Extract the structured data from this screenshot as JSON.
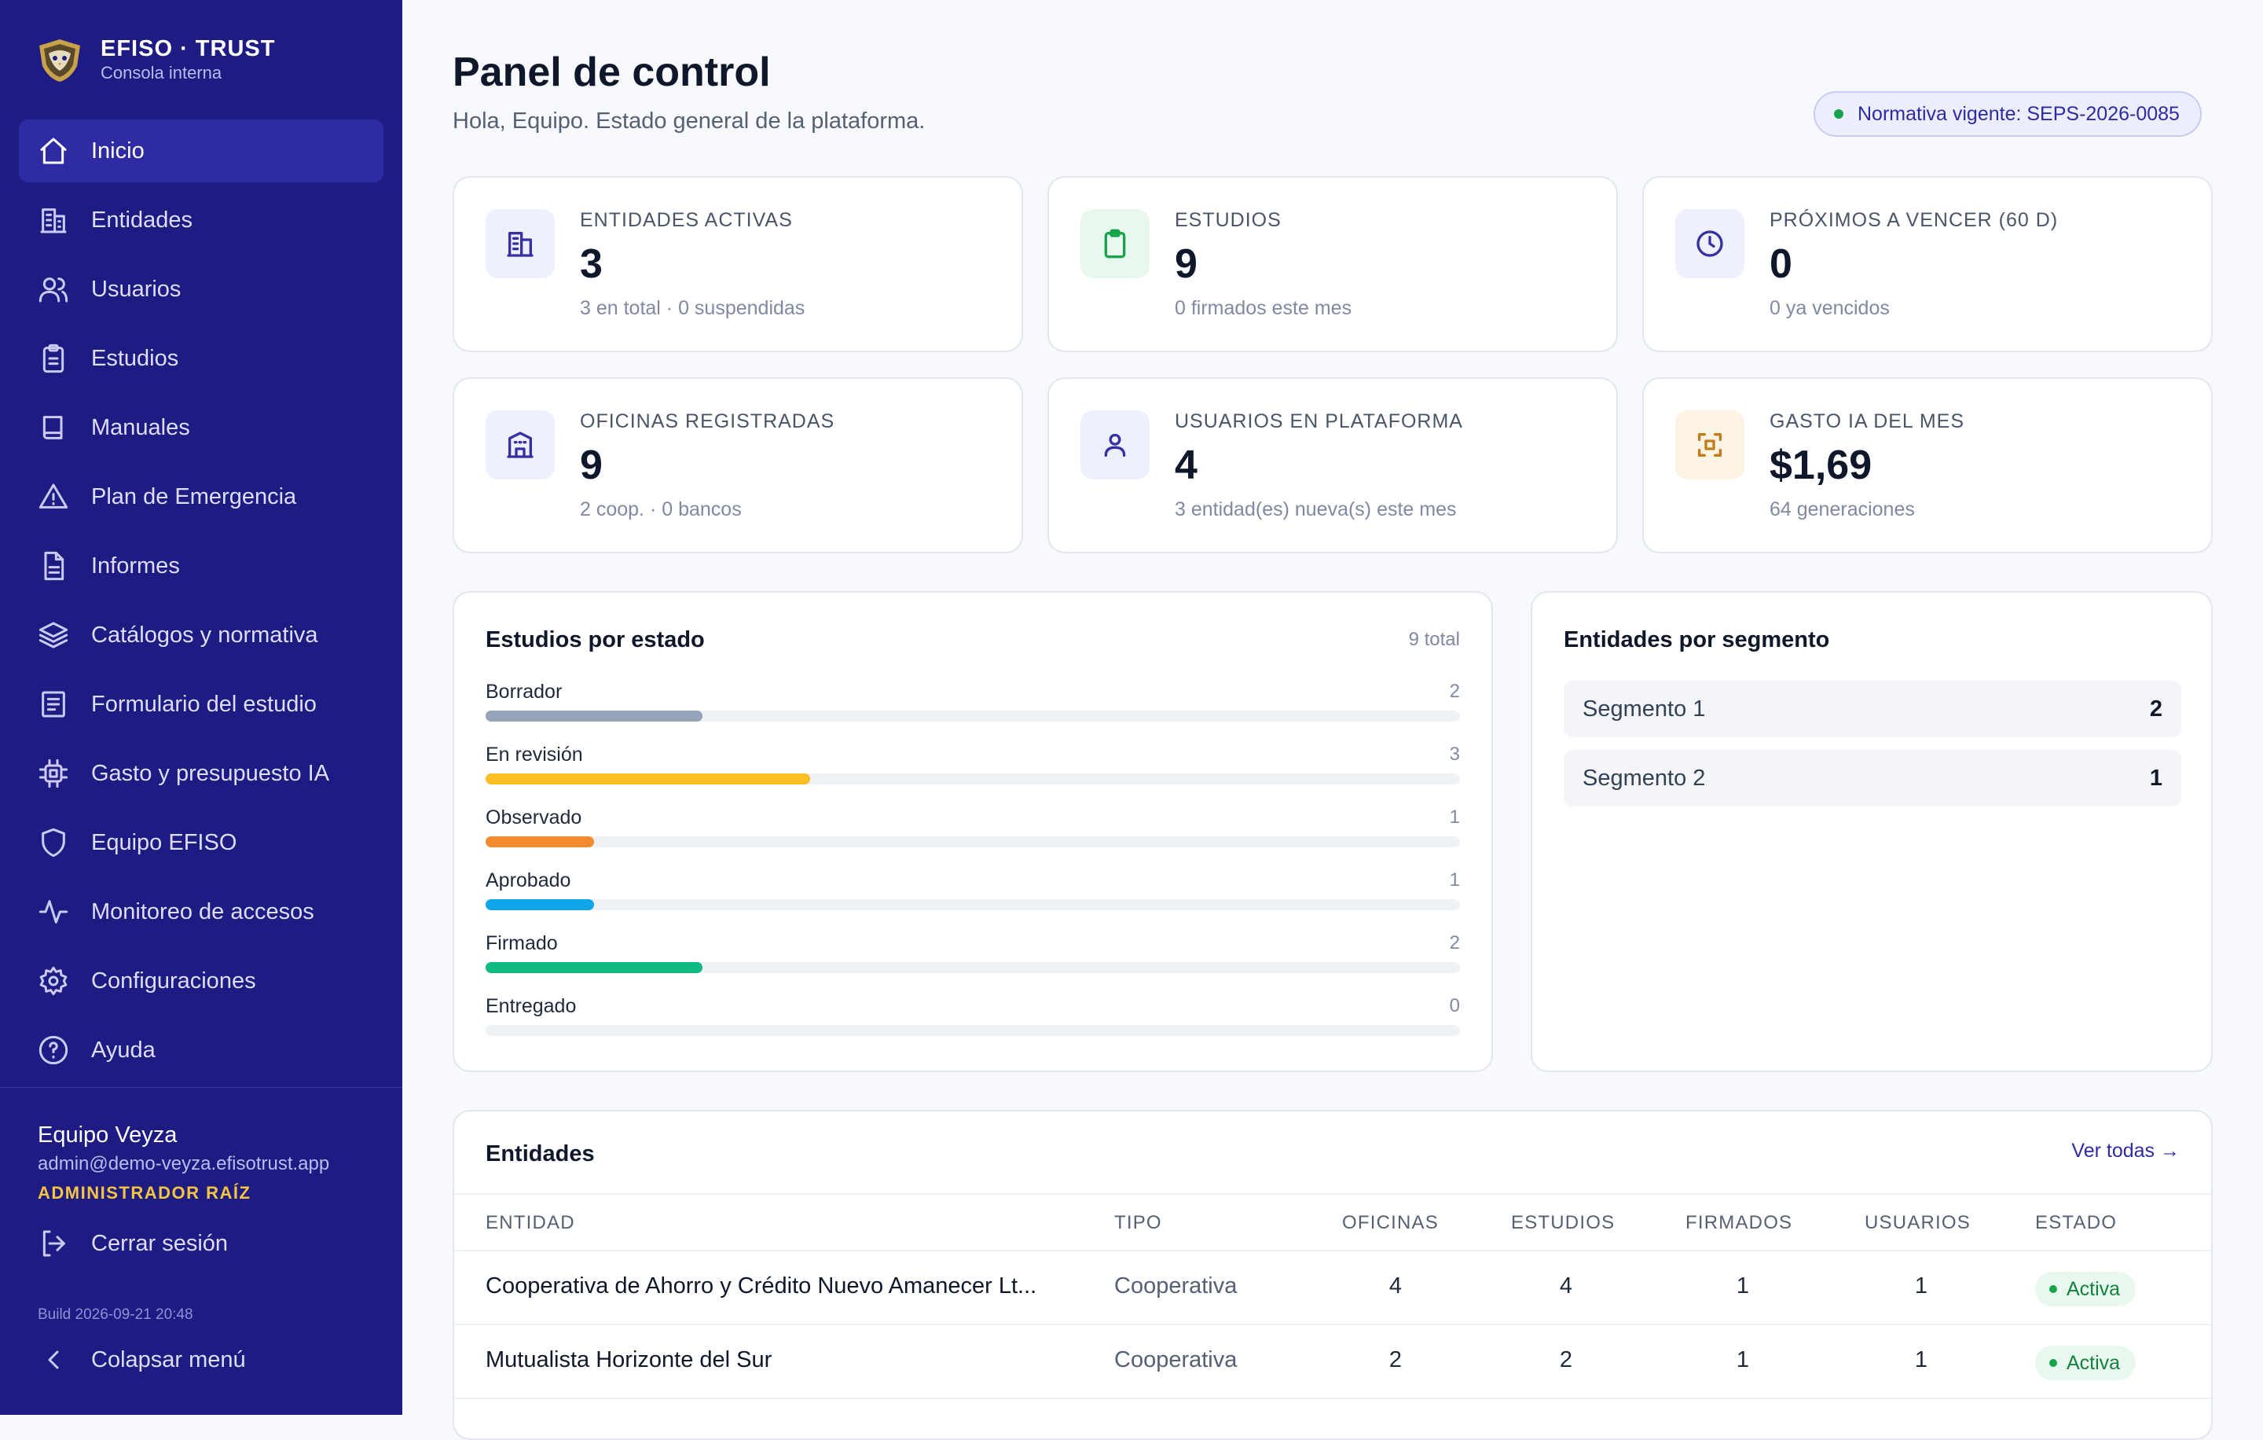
{
  "brand": {
    "title": "EFISO · TRUST",
    "subtitle": "Consola interna"
  },
  "nav": [
    {
      "label": "Inicio",
      "icon": "home-icon",
      "active": true
    },
    {
      "label": "Entidades",
      "icon": "building-icon"
    },
    {
      "label": "Usuarios",
      "icon": "users-icon"
    },
    {
      "label": "Estudios",
      "icon": "clipboard-icon"
    },
    {
      "label": "Manuales",
      "icon": "book-icon"
    },
    {
      "label": "Plan de Emergencia",
      "icon": "warning-icon"
    },
    {
      "label": "Informes",
      "icon": "file-icon"
    },
    {
      "label": "Catálogos y normativa",
      "icon": "layers-icon"
    },
    {
      "label": "Formulario del estudio",
      "icon": "form-icon"
    },
    {
      "label": "Gasto y presupuesto IA",
      "icon": "chip-icon"
    },
    {
      "label": "Equipo EFISO",
      "icon": "shield-icon"
    },
    {
      "label": "Monitoreo de accesos",
      "icon": "activity-icon"
    },
    {
      "label": "Configuraciones",
      "icon": "gear-icon"
    },
    {
      "label": "Ayuda",
      "icon": "help-icon"
    }
  ],
  "user": {
    "name": "Equipo Veyza",
    "email": "admin@demo-veyza.efisotrust.app",
    "role": "ADMINISTRADOR RAÍZ"
  },
  "footer": {
    "logout": "Cerrar sesión",
    "build": "Build 2026-09-21 20:48",
    "collapse": "Colapsar menú"
  },
  "header": {
    "title": "Panel de control",
    "subtitle": "Hola, Equipo. Estado general de la plataforma.",
    "normativa": "Normativa vigente: SEPS-2026-0085"
  },
  "stats": [
    {
      "label": "ENTIDADES ACTIVAS",
      "value": "3",
      "note": "3 en total · 0 suspendidas",
      "icon": "building-icon",
      "bg": "#eef0fd",
      "color": "#3730a3"
    },
    {
      "label": "ESTUDIOS",
      "value": "9",
      "note": "0 firmados este mes",
      "icon": "clipboard-icon",
      "bg": "#e8f8ef",
      "color": "#16a34a"
    },
    {
      "label": "PRÓXIMOS A VENCER (60 D)",
      "value": "0",
      "note": "0 ya vencidos",
      "icon": "clock-icon",
      "bg": "#eef0fd",
      "color": "#3730a3"
    },
    {
      "label": "OFICINAS REGISTRADAS",
      "value": "9",
      "note": "2 coop. · 0 bancos",
      "icon": "office-icon",
      "bg": "#eef0fd",
      "color": "#3730a3"
    },
    {
      "label": "USUARIOS EN PLATAFORMA",
      "value": "4",
      "note": "3 entidad(es) nueva(s) este mes",
      "icon": "user-icon",
      "bg": "#eef0fd",
      "color": "#3730a3"
    },
    {
      "label": "GASTO IA DEL MES",
      "value": "$1,69",
      "note": "64 generaciones",
      "icon": "scan-icon",
      "bg": "#fdf3e3",
      "color": "#c27c1a"
    }
  ],
  "estudios": {
    "title": "Estudios por estado",
    "total_label": "9 total",
    "states": [
      {
        "label": "Borrador",
        "value": 2,
        "color": "#94a3b8"
      },
      {
        "label": "En revisión",
        "value": 3,
        "color": "#fbbf24"
      },
      {
        "label": "Observado",
        "value": 1,
        "color": "#f28b30"
      },
      {
        "label": "Aprobado",
        "value": 1,
        "color": "#0ea5e9"
      },
      {
        "label": "Firmado",
        "value": 2,
        "color": "#10b981"
      },
      {
        "label": "Entregado",
        "value": 0,
        "color": "#94a3b8"
      }
    ],
    "max": 9
  },
  "segmentos": {
    "title": "Entidades por segmento",
    "rows": [
      {
        "label": "Segmento 1",
        "value": "2"
      },
      {
        "label": "Segmento 2",
        "value": "1"
      }
    ]
  },
  "entidades": {
    "title": "Entidades",
    "ver_todas": "Ver todas →",
    "columns": [
      "ENTIDAD",
      "TIPO",
      "OFICINAS",
      "ESTUDIOS",
      "FIRMADOS",
      "USUARIOS",
      "ESTADO"
    ],
    "rows": [
      {
        "entidad": "Cooperativa de Ahorro y Crédito Nuevo Amanecer Lt...",
        "tipo": "Cooperativa",
        "oficinas": "4",
        "estudios": "4",
        "firmados": "1",
        "usuarios": "1",
        "estado": "Activa"
      },
      {
        "entidad": "Mutualista Horizonte del Sur",
        "tipo": "Cooperativa",
        "oficinas": "2",
        "estudios": "2",
        "firmados": "1",
        "usuarios": "1",
        "estado": "Activa"
      }
    ]
  }
}
